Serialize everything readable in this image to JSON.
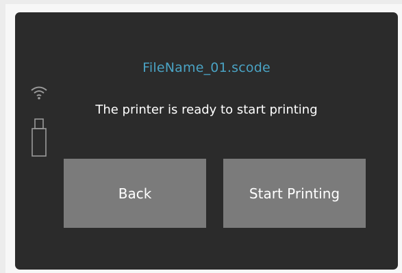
{
  "file": {
    "name": "FileName_01.scode"
  },
  "status": {
    "message": "The printer is ready to start printing"
  },
  "indicators": {
    "wifi_icon": "wifi-icon",
    "usb_icon": "usb-drive-icon"
  },
  "actions": {
    "back_label": "Back",
    "start_label": "Start Printing"
  },
  "colors": {
    "screen_background": "#2b2b2b",
    "file_name": "#4aa3c4",
    "button_background": "#7b7b7b",
    "text": "#ffffff"
  }
}
